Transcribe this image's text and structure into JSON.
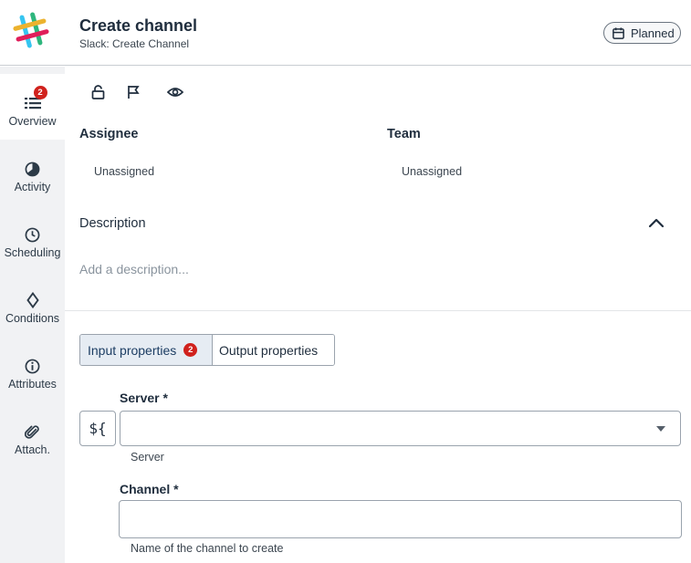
{
  "header": {
    "title": "Create channel",
    "subtitle": "Slack: Create Channel",
    "status": "Planned"
  },
  "sidebar": {
    "items": [
      {
        "label": "Overview",
        "icon": "list-icon",
        "badge": "2",
        "active": true
      },
      {
        "label": "Activity",
        "icon": "pie-icon"
      },
      {
        "label": "Scheduling",
        "icon": "clock-icon"
      },
      {
        "label": "Conditions",
        "icon": "diamond-icon"
      },
      {
        "label": "Attributes",
        "icon": "info-icon"
      },
      {
        "label": "Attach.",
        "icon": "paperclip-icon"
      }
    ]
  },
  "toolbar": {
    "icons": [
      "lock-icon",
      "flag-icon",
      "eye-icon"
    ]
  },
  "details": {
    "assignee_label": "Assignee",
    "assignee_value": "Unassigned",
    "team_label": "Team",
    "team_value": "Unassigned"
  },
  "description": {
    "title": "Description",
    "placeholder": "Add a description..."
  },
  "tabs": {
    "input_label": "Input properties",
    "input_badge": "2",
    "output_label": "Output properties"
  },
  "form": {
    "expression_label": "${",
    "server_label": "Server",
    "server_required": "*",
    "server_help": "Server",
    "server_value": "",
    "channel_label": "Channel",
    "channel_required": "*",
    "channel_help": "Name of the channel to create",
    "channel_value": ""
  },
  "colors": {
    "badge": "#d0211c",
    "active_tab": "#e6ecf3",
    "sidebar_bg": "#f1f2f4"
  }
}
